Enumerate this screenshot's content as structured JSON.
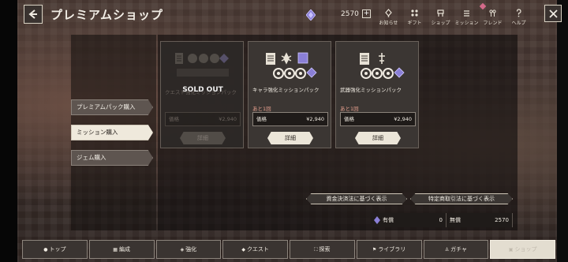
{
  "header": {
    "title": "プレミアムショップ",
    "currency_amount": "2570",
    "plus_label": "+",
    "nav": [
      {
        "label": "お知らせ",
        "icon": "bell-icon"
      },
      {
        "label": "ギフト",
        "icon": "gift-icon"
      },
      {
        "label": "ショップ",
        "icon": "shop-icon"
      },
      {
        "label": "ミッション",
        "icon": "mission-icon"
      },
      {
        "label": "フレンド",
        "icon": "friend-icon"
      },
      {
        "label": "ヘルプ",
        "icon": "help-icon"
      }
    ]
  },
  "tabs": [
    {
      "label": "プレミアムパック購入",
      "active": false
    },
    {
      "label": "ミッション購入",
      "active": true
    },
    {
      "label": "ジェム購入",
      "active": false
    }
  ],
  "cards": [
    {
      "name": "クエスト強化ミッションパック",
      "soldout_label": "SOLD OUT",
      "price_label": "価格",
      "price": "¥2,940",
      "detail_label": "詳細",
      "sold_out": true
    },
    {
      "name": "キャラ強化ミッションパック",
      "remaining": "あと1回",
      "price_label": "価格",
      "price": "¥2,940",
      "detail_label": "詳細",
      "sold_out": false
    },
    {
      "name": "武器強化ミッションパック",
      "remaining": "あと1回",
      "price_label": "価格",
      "price": "¥2,940",
      "detail_label": "詳細",
      "sold_out": false
    }
  ],
  "legal": {
    "funds_label": "資金決済法に基づく表示",
    "commerce_label": "特定商取引法に基づく表示"
  },
  "balance": {
    "paid_label": "有償",
    "paid_value": "0",
    "free_label": "無償",
    "free_value": "2570"
  },
  "bottom_nav": [
    {
      "label": "トップ"
    },
    {
      "label": "編成"
    },
    {
      "label": "強化"
    },
    {
      "label": "クエスト"
    },
    {
      "label": "探索"
    },
    {
      "label": "ライブラリ"
    },
    {
      "label": "ガチャ"
    },
    {
      "label": "ショップ"
    }
  ],
  "colors": {
    "accent_pink": "#e7a08f",
    "gem_purple": "#8a7fd6",
    "active_tab": "#efe9dc"
  }
}
